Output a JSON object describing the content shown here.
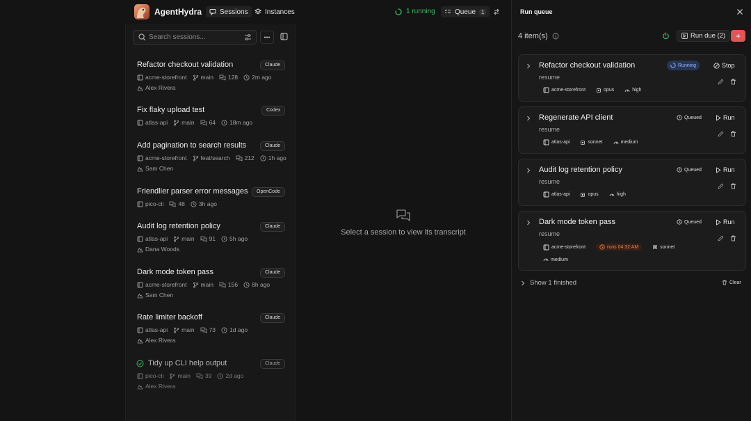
{
  "app": {
    "title": "AgentHydra"
  },
  "nav": {
    "sessions": "Sessions",
    "instances": "Instances"
  },
  "status": {
    "running": "1 running",
    "queue_label": "Queue",
    "queue_count": "1"
  },
  "search": {
    "placeholder": "Search sessions..."
  },
  "sessions": [
    {
      "title": "Refactor checkout validation",
      "agent": "Claude",
      "repo": "acme-storefront",
      "branch": "main",
      "messages": "128",
      "time": "2m ago",
      "user": "Alex Rivera"
    },
    {
      "title": "Fix flaky upload test",
      "agent": "Codex",
      "repo": "atlas-api",
      "branch": "main",
      "messages": "64",
      "time": "18m ago",
      "user": ""
    },
    {
      "title": "Add pagination to search results",
      "agent": "Claude",
      "repo": "acme-storefront",
      "branch": "feat/search",
      "messages": "212",
      "time": "1h ago",
      "user": "Sam Chen"
    },
    {
      "title": "Friendlier parser error messages",
      "agent": "OpenCode",
      "repo": "pico-cli",
      "branch": "",
      "messages": "48",
      "time": "3h ago",
      "user": ""
    },
    {
      "title": "Audit log retention policy",
      "agent": "Claude",
      "repo": "atlas-api",
      "branch": "main",
      "messages": "91",
      "time": "5h ago",
      "user": "Dana Woods"
    },
    {
      "title": "Dark mode token pass",
      "agent": "Claude",
      "repo": "acme-storefront",
      "branch": "main",
      "messages": "156",
      "time": "8h ago",
      "user": "Sam Chen"
    },
    {
      "title": "Rate limiter backoff",
      "agent": "Claude",
      "repo": "atlas-api",
      "branch": "main",
      "messages": "73",
      "time": "1d ago",
      "user": "Alex Rivera"
    },
    {
      "title": "Tidy up CLI help output",
      "agent": "Claude",
      "repo": "pico-cli",
      "branch": "main",
      "messages": "39",
      "time": "2d ago",
      "user": "Alex Rivera",
      "completed": true
    }
  ],
  "center": {
    "empty_text": "Select a session to view its transcript"
  },
  "run_queue": {
    "title": "Run queue",
    "items_count": "4 item(s)",
    "run_due": "Run due (2)",
    "show_finished": "Show 1 finished",
    "clear": "Clear",
    "items": [
      {
        "title": "Refactor checkout validation",
        "mode": "resume",
        "status": "Running",
        "action": "Stop",
        "repo": "acme-storefront",
        "model": "opus",
        "effort": "high",
        "schedule": ""
      },
      {
        "title": "Regenerate API client",
        "mode": "resume",
        "status": "Queued",
        "action": "Run",
        "repo": "atlas-api",
        "model": "sonnet",
        "effort": "medium",
        "schedule": ""
      },
      {
        "title": "Audit log retention policy",
        "mode": "resume",
        "status": "Queued",
        "action": "Run",
        "repo": "atlas-api",
        "model": "opus",
        "effort": "high",
        "schedule": ""
      },
      {
        "title": "Dark mode token pass",
        "mode": "resume",
        "status": "Queued",
        "action": "Run",
        "repo": "acme-storefront",
        "model": "sonnet",
        "effort": "medium",
        "schedule": "runs 04:32 AM"
      }
    ]
  },
  "colors": {
    "accent_red": "#e05555",
    "running_green": "#3fb866",
    "running_blue": "#93b4ff",
    "schedule_orange": "#e08a5a"
  }
}
